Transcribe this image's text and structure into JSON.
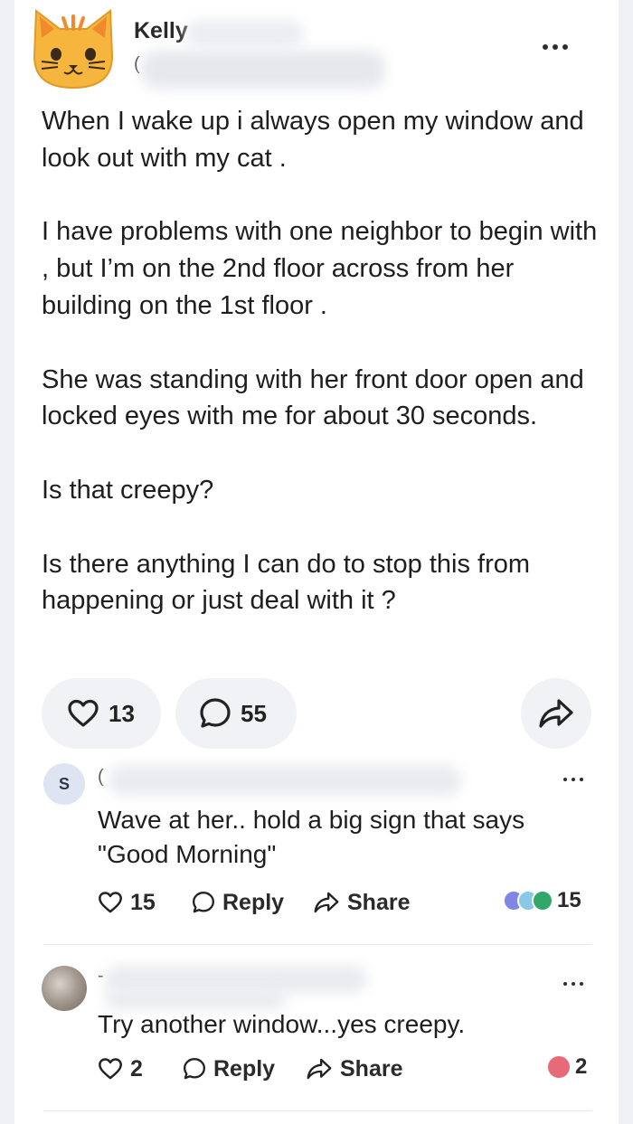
{
  "post": {
    "author_name": "Kelly",
    "author_sub": "(",
    "paragraphs": [
      "When I wake up i always open my window and look out with my cat .",
      "I have problems with one neighbor to begin with , but I’m on the 2nd floor across from her building on the 1st floor .",
      "She was standing with her front door open and locked eyes with me for about 30 seconds.",
      "Is that creepy?",
      "Is there anything I can do to stop this from happening or just deal with it ?"
    ],
    "likes": "13",
    "comments": "55",
    "avatar_icon": "cat-face-emoji",
    "colors": {
      "accent": "#f1f2f5",
      "avatar_bg": "#f6b53c"
    }
  },
  "comments": [
    {
      "avatar_letter": "S",
      "author_fragment": "(",
      "text": "Wave at her.. hold a big sign that says \"Good Morning\"",
      "likes": "15",
      "reply_label": "Reply",
      "share_label": "Share",
      "reaction_count": "15"
    },
    {
      "author_fragment": "-",
      "text": "Try another window...yes creepy.",
      "likes": "2",
      "reply_label": "Reply",
      "share_label": "Share",
      "reaction_count": "2"
    }
  ]
}
